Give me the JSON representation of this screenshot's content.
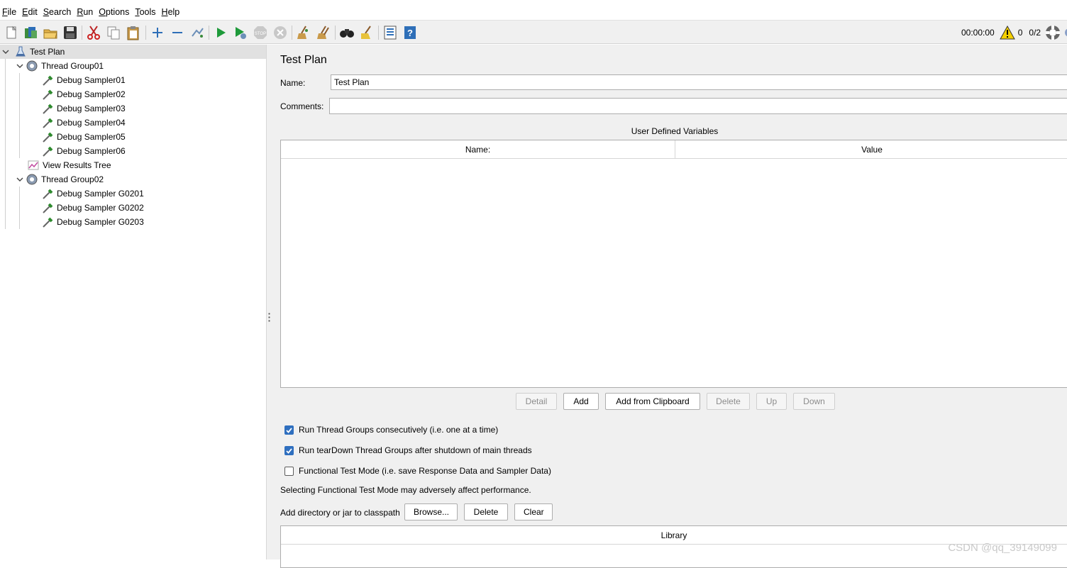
{
  "menu": [
    {
      "mnemonic": "F",
      "rest": "ile"
    },
    {
      "mnemonic": "E",
      "rest": "dit"
    },
    {
      "mnemonic": "S",
      "rest": "earch"
    },
    {
      "mnemonic": "R",
      "rest": "un"
    },
    {
      "mnemonic": "O",
      "rest": "ptions"
    },
    {
      "mnemonic": "T",
      "rest": "ools"
    },
    {
      "mnemonic": "H",
      "rest": "elp"
    }
  ],
  "toolbar": {
    "icons": [
      "new-icon",
      "templates-icon",
      "open-icon",
      "save-icon",
      "cut-icon",
      "copy-icon",
      "paste-icon",
      "expand-icon",
      "collapse-icon",
      "toggle-icon",
      "start-icon",
      "start-no-pauses-icon",
      "stop-icon",
      "shutdown-icon",
      "clear-icon",
      "clear-all-icon",
      "search-icon",
      "reset-search-icon",
      "function-helper-icon",
      "help-icon"
    ],
    "timer": "00:00:00",
    "warning_count": "0",
    "threads": "0/2"
  },
  "tree": {
    "test_plan": "Test Plan",
    "group1": {
      "label": "Thread Group01",
      "samplers": [
        "Debug Sampler01",
        "Debug Sampler02",
        "Debug Sampler03",
        "Debug Sampler04",
        "Debug Sampler05",
        "Debug Sampler06"
      ]
    },
    "listener": "View Results Tree",
    "group2": {
      "label": "Thread Group02",
      "samplers": [
        "Debug Sampler G0201",
        "Debug Sampler G0202",
        "Debug Sampler G0203"
      ]
    }
  },
  "panel": {
    "title": "Test Plan",
    "name_label": "Name:",
    "name_value": "Test Plan",
    "comments_label": "Comments:",
    "comments_value": "",
    "udv_title": "User Defined Variables",
    "col_name": "Name:",
    "col_value": "Value",
    "btn_detail": "Detail",
    "btn_add": "Add",
    "btn_add_clipboard": "Add from Clipboard",
    "btn_delete": "Delete",
    "btn_up": "Up",
    "btn_down": "Down",
    "chk_consecutive": "Run Thread Groups consecutively (i.e. one at a time)",
    "chk_teardown": "Run tearDown Thread Groups after shutdown of main threads",
    "chk_functional": "Functional Test Mode (i.e. save Response Data and Sampler Data)",
    "functional_note": "Selecting Functional Test Mode may adversely affect performance.",
    "classpath_label": "Add directory or jar to classpath",
    "btn_browse": "Browse...",
    "btn_cp_delete": "Delete",
    "btn_clear": "Clear",
    "library_header": "Library"
  },
  "watermark": "CSDN @qq_39149099"
}
